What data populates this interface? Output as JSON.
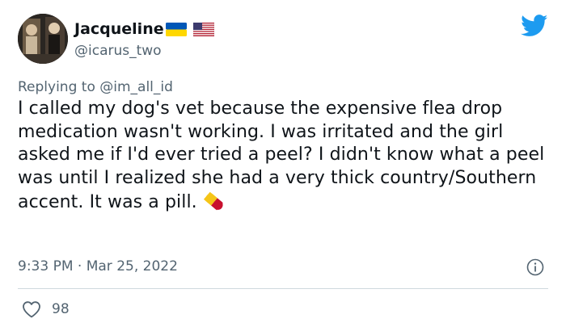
{
  "author": {
    "display_name": "Jacqueline",
    "handle": "@icarus_two"
  },
  "reply_context": {
    "prefix": "Replying to",
    "mention": "@im_all_id"
  },
  "tweet": {
    "text": "I called my dog's vet because the expensive flea drop medication wasn't working. I was irritated and the girl asked me if I'd ever tried a peel? I didn't know what a peel was until I realized she had a very thick country/Southern accent. It was a pill.",
    "timestamp": "9:33 PM · Mar 25, 2022"
  },
  "engagement": {
    "likes": "98"
  },
  "icons": {
    "brand": "twitter-bird-icon",
    "flags": [
      "ukraine-flag-icon",
      "us-flag-icon"
    ],
    "emoji": "pill-emoji",
    "info": "info-icon",
    "like": "heart-icon"
  },
  "colors": {
    "brand_blue": "#1d9bf0",
    "secondary_text": "#536471",
    "primary_text": "#0f1419",
    "divider": "#cfd9de",
    "ukraine_blue": "#0057b7",
    "ukraine_yellow": "#ffd700",
    "pill_red": "#c8102e",
    "pill_yellow": "#f5c518"
  }
}
